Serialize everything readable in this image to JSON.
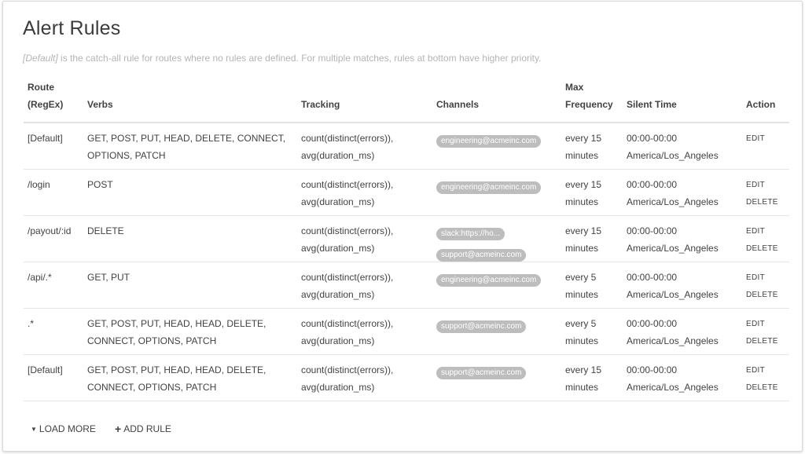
{
  "page": {
    "title": "Alert Rules",
    "subtitle_prefix": "[Default]",
    "subtitle_text": " is the catch-all rule for routes where no rules are defined. For multiple matches, rules at bottom have higher priority."
  },
  "table": {
    "headers": {
      "route_line1": "Route",
      "route_line2": "(RegEx)",
      "verbs": "Verbs",
      "tracking": "Tracking",
      "channels": "Channels",
      "freq_line1": "Max",
      "freq_line2": "Frequency",
      "silent": "Silent Time",
      "action": "Action"
    },
    "rows": [
      {
        "route": "[Default]",
        "verbs_1": "GET, POST, PUT, HEAD, DELETE, CONNECT,",
        "verbs_2": "OPTIONS, PATCH",
        "track_1": "count(distinct(errors)),",
        "track_2": "avg(duration_ms)",
        "channels": [
          "engineering@acmeinc.com"
        ],
        "freq_1": "every 15",
        "freq_2": "minutes",
        "silent_1": "00:00-00:00",
        "silent_2": "America/Los_Angeles",
        "edit": "EDIT"
      },
      {
        "route": "/login",
        "verbs_1": "POST",
        "verbs_2": "",
        "track_1": "count(distinct(errors)),",
        "track_2": "avg(duration_ms)",
        "channels": [
          "engineering@acmeinc.com"
        ],
        "freq_1": "every 15",
        "freq_2": "minutes",
        "silent_1": "00:00-00:00",
        "silent_2": "America/Los_Angeles",
        "edit": "EDIT",
        "delete": "DELETE"
      },
      {
        "route": "/payout/:id",
        "verbs_1": "DELETE",
        "verbs_2": "",
        "track_1": "count(distinct(errors)),",
        "track_2": "avg(duration_ms)",
        "channels": [
          "slack:https://ho...",
          "support@acmeinc.com"
        ],
        "freq_1": "every 15",
        "freq_2": "minutes",
        "silent_1": "00:00-00:00",
        "silent_2": "America/Los_Angeles",
        "edit": "EDIT",
        "delete": "DELETE"
      },
      {
        "route": "/api/.*",
        "verbs_1": "GET, PUT",
        "verbs_2": "",
        "track_1": "count(distinct(errors)),",
        "track_2": "avg(duration_ms)",
        "channels": [
          "engineering@acmeinc.com"
        ],
        "freq_1": "every 5",
        "freq_2": "minutes",
        "silent_1": "00:00-00:00",
        "silent_2": "America/Los_Angeles",
        "edit": "EDIT",
        "delete": "DELETE"
      },
      {
        "route": ".*",
        "verbs_1": "GET, POST, PUT, HEAD, HEAD, DELETE,",
        "verbs_2": "CONNECT, OPTIONS, PATCH",
        "track_1": "count(distinct(errors)),",
        "track_2": "avg(duration_ms)",
        "channels": [
          "support@acmeinc.com"
        ],
        "freq_1": "every 5",
        "freq_2": "minutes",
        "silent_1": "00:00-00:00",
        "silent_2": "America/Los_Angeles",
        "edit": "EDIT",
        "delete": "DELETE"
      },
      {
        "route": "[Default]",
        "verbs_1": "GET, POST, PUT, HEAD, HEAD, DELETE,",
        "verbs_2": "CONNECT, OPTIONS, PATCH",
        "track_1": "count(distinct(errors)),",
        "track_2": "avg(duration_ms)",
        "channels": [
          "support@acmeinc.com"
        ],
        "freq_1": "every 15",
        "freq_2": "minutes",
        "silent_1": "00:00-00:00",
        "silent_2": "America/Los_Angeles",
        "edit": "EDIT",
        "delete": "DELETE"
      }
    ]
  },
  "footer": {
    "load_more_icon": "caret-down-icon",
    "load_more_label": "LOAD MORE",
    "add_rule_icon": "plus-icon",
    "add_rule_label": "ADD RULE"
  },
  "colors": {
    "chip_bg": "#bdbdbd",
    "text": "#424242",
    "subtitle": "#b4b4b4"
  }
}
